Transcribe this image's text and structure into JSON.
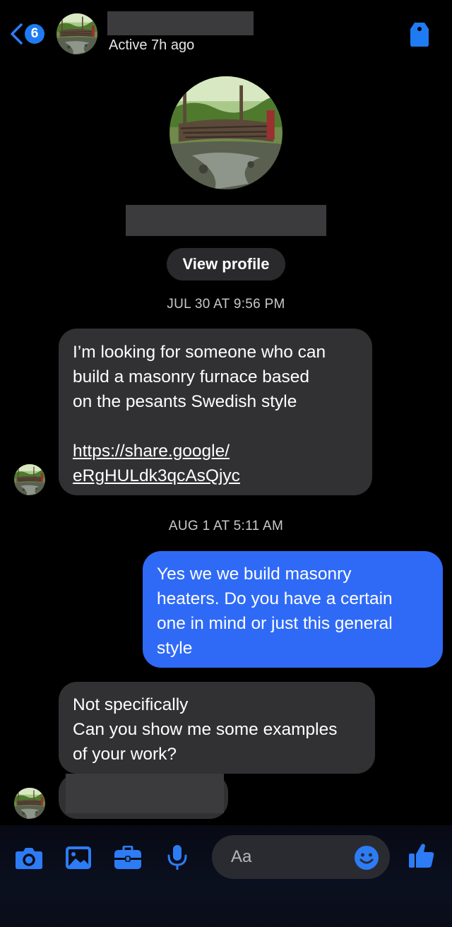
{
  "header": {
    "back_count": "6",
    "status": "Active 7h ago",
    "name_redacted": true
  },
  "profile": {
    "view_profile_label": "View profile",
    "name_redacted": true
  },
  "conversation": {
    "timestamps": [
      "JUL 30 AT 9:56 PM",
      "AUG 1 AT 5:11 AM"
    ],
    "messages": [
      {
        "direction": "incoming",
        "lines": [
          "I’m looking for someone who can",
          "build a masonry furnace based",
          "on the pesants Swedish style"
        ],
        "link_lines": [
          "https://share.google/",
          "eRgHULdk3qcAsQjyc"
        ]
      },
      {
        "direction": "outgoing",
        "lines": [
          "Yes we we build  masonry",
          "heaters.  Do you have a certain",
          "one in mind or just this general",
          "style"
        ]
      },
      {
        "direction": "incoming",
        "lines": [
          "Not specifically",
          "Can you show me some examples",
          "of your work?"
        ]
      },
      {
        "direction": "incoming",
        "redacted": true
      }
    ]
  },
  "composer": {
    "placeholder": "Aa",
    "icons": [
      "camera-icon",
      "photo-icon",
      "briefcase-icon",
      "microphone-icon",
      "emoji-icon",
      "thumbs-up-icon"
    ]
  },
  "colors": {
    "accent": "#2f6af7",
    "incoming_bubble": "#313133",
    "background": "#000000"
  }
}
